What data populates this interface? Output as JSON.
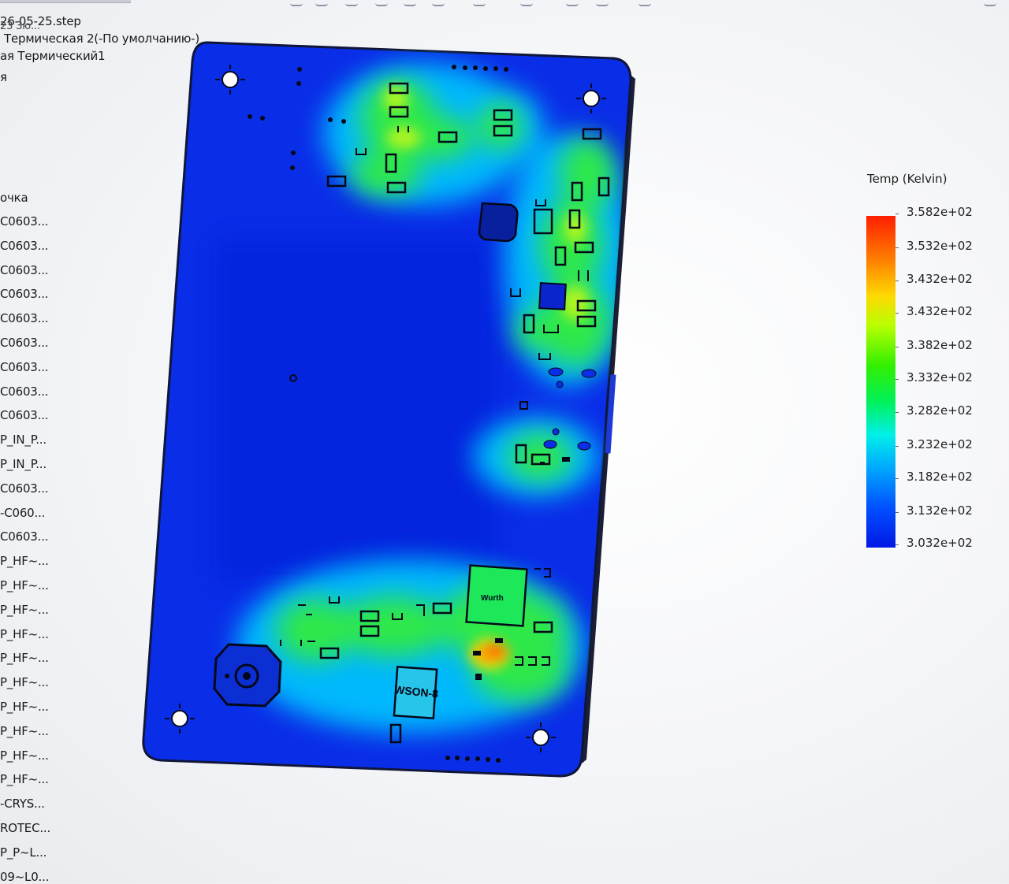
{
  "toolbar": {
    "icons": [
      "pen-icon",
      "magnifier-icon",
      "hand-icon",
      "gear-icon",
      "layers-icon",
      "tool-icon",
      "box-icon",
      "eye-icon",
      "pin-icon",
      "pencil-icon",
      "grid-icon",
      "cursor-icon"
    ]
  },
  "tree": {
    "file_name": "26-05-25.step",
    "file_overlap": "23 Зю...",
    "items": [
      "Термическая 2(-По умолчанию-)",
      "ая Термический1",
      "я",
      "очка",
      "C0603...",
      "C0603...",
      "C0603...",
      "C0603...",
      "C0603...",
      "C0603...",
      "C0603...",
      "C0603...",
      "C0603...",
      "P_IN_P...",
      "P_IN_P...",
      "C0603...",
      "-C060...",
      "C0603...",
      "P_HF~...",
      "P_HF~...",
      "P_HF~...",
      "P_HF~...",
      "P_HF~...",
      "P_HF~...",
      "P_HF~...",
      "P_HF~...",
      "P_HF~...",
      "P_HF~...",
      "-CRYS...",
      "ROTEC...",
      "P_P~L...",
      "09~L0..."
    ]
  },
  "board": {
    "label_regulator": "WSON-8",
    "label_inductor": "Wurth"
  },
  "legend": {
    "title": "Temp (Kelvin)",
    "values": [
      "3.582e+02",
      "3.532e+02",
      "3.432e+02",
      "3.432e+02",
      "3.382e+02",
      "3.332e+02",
      "3.282e+02",
      "3.232e+02",
      "3.182e+02",
      "3.132e+02",
      "3.032e+02"
    ],
    "color_max": "#ff1e00",
    "color_min": "#0018e6"
  }
}
